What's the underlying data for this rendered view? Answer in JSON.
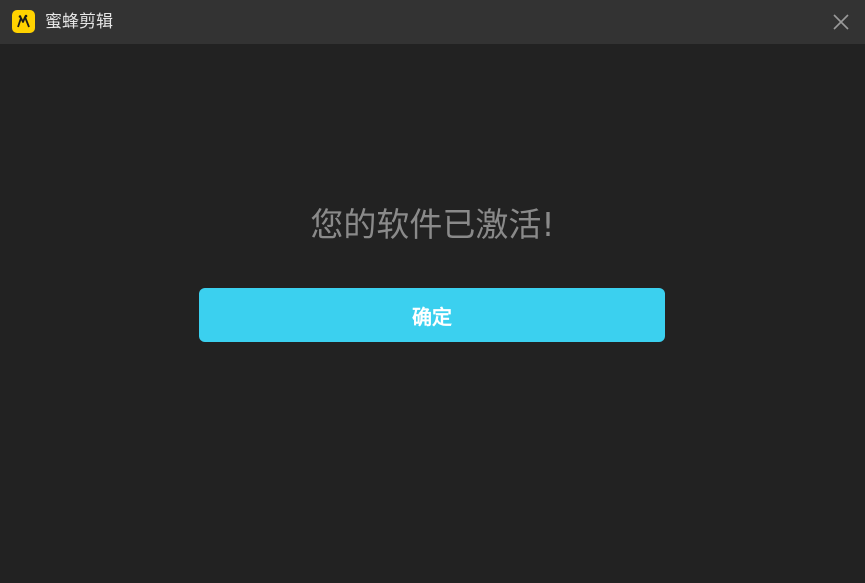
{
  "window": {
    "title": "蜜蜂剪辑",
    "logo_icon": "bee-logo-icon",
    "close_icon": "close-icon"
  },
  "dialog": {
    "message": "您的软件已激活!",
    "confirm_label": "确定"
  },
  "colors": {
    "background": "#222222",
    "titlebar": "#333333",
    "accent": "#3bd0ef",
    "logo": "#ffd200",
    "message_text": "#8a8a8a"
  }
}
